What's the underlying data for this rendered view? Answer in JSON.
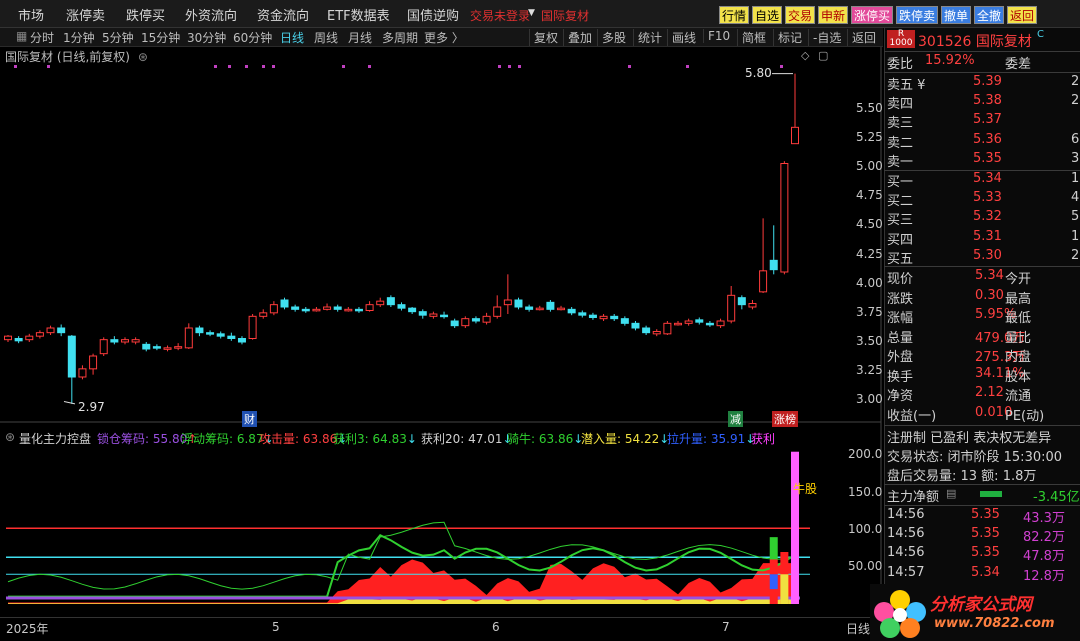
{
  "menu": {
    "items": [
      "市场",
      "涨停卖",
      "跌停买",
      "外资流向",
      "资金流向",
      "ETF数据表",
      "国债逆购"
    ],
    "red_items": [
      "交易未登录",
      "国际复材"
    ],
    "tool_buttons": [
      "行情",
      "自选",
      "交易",
      "申新",
      "涨停买",
      "跌停卖",
      "撤单",
      "全撤",
      "返回"
    ]
  },
  "periods": {
    "items": [
      "分时",
      "1分钟",
      "5分钟",
      "15分钟",
      "30分钟",
      "60分钟",
      "日线",
      "周线",
      "月线",
      "多周期",
      "更多 〉"
    ],
    "active": "日线",
    "tools": [
      "复权",
      "叠加",
      "多股",
      "统计",
      "画线",
      "F10",
      "简框",
      "标记",
      "-自选",
      "返回"
    ]
  },
  "chart_title": "国际复材 (日线,前复权)",
  "chart_data": [
    {
      "type": "candlestick",
      "title": "国际复材 (日线,前复权)",
      "y_ticks": [
        "5.50",
        "5.25",
        "5.00",
        "4.75",
        "4.50",
        "4.25",
        "4.00",
        "3.75",
        "3.50",
        "3.25",
        "3.00"
      ],
      "ylim": [
        2.9,
        5.9
      ],
      "x_ticks": [
        "2025年",
        "5",
        "6",
        "7",
        "日线"
      ],
      "annotations": {
        "high": "5.80",
        "low": "2.97"
      },
      "markers": [
        "财",
        "减",
        "涨榜"
      ]
    },
    {
      "type": "area",
      "title": "量化主力控盘",
      "y_ticks": [
        "200.0",
        "150.0",
        "100.0",
        "50.00"
      ],
      "ylim": [
        0,
        210
      ],
      "signal_label": "牛股",
      "legend": [
        {
          "name": "锁仓筹码",
          "value": "55.80",
          "arrow": "↑",
          "color": "#9a50e0"
        },
        {
          "name": "浮动筹码",
          "value": "6.87",
          "arrow": "↓",
          "color": "#30d030"
        },
        {
          "name": "攻击量",
          "value": "63.86",
          "arrow": "↓",
          "color": "#ff4040"
        },
        {
          "name": "获利3",
          "value": "64.83",
          "arrow": "↓",
          "color": "#30d030"
        },
        {
          "name": "获利20",
          "value": "47.01",
          "arrow": "↓",
          "color": "#d0d0d0"
        },
        {
          "name": "骑牛",
          "value": "63.86",
          "arrow": "↓",
          "color": "#30d030"
        },
        {
          "name": "潜入量",
          "value": "54.22",
          "arrow": "↓",
          "color": "#f0e040"
        },
        {
          "name": "拉升量",
          "value": "35.91",
          "arrow": "↓",
          "color": "#3060ff"
        },
        {
          "name": "获利",
          "value": "",
          "arrow": "",
          "color": "#ff40ff"
        }
      ]
    }
  ],
  "quote": {
    "logo_letter": "R",
    "logo_num": "1000",
    "code_name": "301526 国际复材",
    "suffix": "C",
    "weibi_label": "委比",
    "weibi_val": "15.92%",
    "weicha_label": "委差",
    "asks": [
      {
        "label": "卖五 ¥",
        "price": "5.39",
        "vol": "2"
      },
      {
        "label": "卖四",
        "price": "5.38",
        "vol": "2"
      },
      {
        "label": "卖三",
        "price": "5.37",
        "vol": ""
      },
      {
        "label": "卖二",
        "price": "5.36",
        "vol": "6"
      },
      {
        "label": "卖一",
        "price": "5.35",
        "vol": "3"
      }
    ],
    "bids": [
      {
        "label": "买一",
        "price": "5.34",
        "vol": "1"
      },
      {
        "label": "买二",
        "price": "5.33",
        "vol": "4"
      },
      {
        "label": "买三",
        "price": "5.32",
        "vol": "5"
      },
      {
        "label": "买四",
        "price": "5.31",
        "vol": "1"
      },
      {
        "label": "买五",
        "price": "5.30",
        "vol": "2"
      }
    ],
    "stats": [
      {
        "l": "现价",
        "v": "5.34",
        "e": "今开"
      },
      {
        "l": "涨跌",
        "v": "0.30",
        "e": "最高"
      },
      {
        "l": "涨幅",
        "v": "5.95%",
        "e": "最低"
      },
      {
        "l": "总量",
        "v": "479.0万",
        "e": "量比"
      },
      {
        "l": "外盘",
        "v": "275.3万",
        "e": "内盘"
      },
      {
        "l": "换手",
        "v": "34.11%",
        "e": "股本"
      },
      {
        "l": "净资",
        "v": "2.12",
        "e": "流通"
      },
      {
        "l": "收益(一)",
        "v": "0.010",
        "e": "PE(动)"
      }
    ],
    "reg_text": "注册制 已盈利 表决权无差异",
    "status_text": "交易状态: 闭市阶段 15:30:00",
    "after_text": "盘后交易量: 13 额: 1.8万",
    "net_label": "主力净额",
    "net_val": "-3.45亿",
    "ticks": [
      {
        "t": "14:56",
        "p": "5.35",
        "v": "43.3万"
      },
      {
        "t": "14:56",
        "p": "5.35",
        "v": "82.2万"
      },
      {
        "t": "14:56",
        "p": "5.35",
        "v": "47.8万"
      },
      {
        "t": "14:57",
        "p": "5.34",
        "v": "12.8万"
      }
    ]
  },
  "watermark": "分析家公式网 www.70822.com",
  "colors": {
    "up": "#ff3b3b",
    "down": "#40e0f0",
    "bg": "#000000",
    "accent": "#4ad0e8"
  }
}
